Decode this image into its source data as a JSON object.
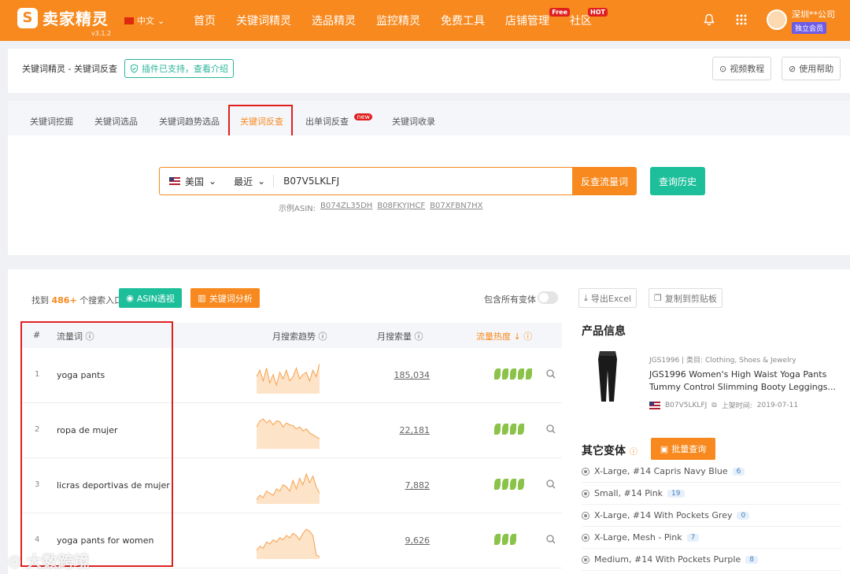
{
  "app": {
    "name": "卖家精灵",
    "version": "v3.1.2",
    "language": "中文"
  },
  "nav": [
    {
      "label": "首页"
    },
    {
      "label": "关键词精灵"
    },
    {
      "label": "选品精灵"
    },
    {
      "label": "监控精灵"
    },
    {
      "label": "免费工具"
    },
    {
      "label": "店铺管理",
      "tag": "Free"
    },
    {
      "label": "社区",
      "tag": "HOT"
    }
  ],
  "user": {
    "company": "深圳**公司",
    "member": "独立会员"
  },
  "header": {
    "breadcrumb": "关键词精灵 - 关键词反查",
    "plugin": "插件已支持，查看介绍",
    "video_btn": "视频教程",
    "help_btn": "使用帮助"
  },
  "tabs": [
    {
      "label": "关键词挖掘"
    },
    {
      "label": "关键词选品"
    },
    {
      "label": "关键词趋势选品"
    },
    {
      "label": "关键词反查"
    },
    {
      "label": "出单词反查",
      "tag": "new"
    },
    {
      "label": "关键词收录"
    }
  ],
  "search": {
    "market": "美国",
    "period": "最近",
    "value": "B07V5LKLFJ",
    "submit": "反查流量词",
    "history": "查询历史",
    "examples_label": "示例ASIN:",
    "examples": [
      "B074ZL35DH",
      "B08FKYJHCF",
      "B07XFBN7HX"
    ]
  },
  "results": {
    "found_prefix": "找到",
    "found_count": "486+",
    "found_suffix": "个搜索入口",
    "asin_btn": "ASIN透视",
    "kw_btn": "关键词分析",
    "variants_label": "包含所有变体",
    "export_btn": "导出Excel",
    "copy_btn": "复制到剪贴板"
  },
  "table": {
    "headers": {
      "num": "#",
      "keyword": "流量词",
      "trend": "月搜索趋势",
      "volume": "月搜索量",
      "heat": "流量热度 ↓"
    },
    "rows": [
      {
        "n": "1",
        "keyword": "yoga pants",
        "volume": "185,034",
        "heat": 5,
        "trend": [
          40,
          55,
          30,
          60,
          25,
          45,
          20,
          50,
          35,
          55,
          30,
          40,
          60,
          35,
          45,
          50,
          30,
          55,
          40,
          70
        ]
      },
      {
        "n": "2",
        "keyword": "ropa de mujer",
        "volume": "22,181",
        "heat": 4,
        "trend": [
          55,
          70,
          75,
          65,
          72,
          60,
          70,
          68,
          55,
          65,
          60,
          58,
          50,
          55,
          45,
          50,
          40,
          35,
          30,
          25
        ]
      },
      {
        "n": "3",
        "keyword": "licras deportivas de mujer",
        "volume": "7,882",
        "heat": 4,
        "trend": [
          10,
          20,
          15,
          30,
          25,
          20,
          35,
          30,
          45,
          40,
          30,
          55,
          35,
          60,
          45,
          70,
          50,
          65,
          40,
          25
        ]
      },
      {
        "n": "4",
        "keyword": "yoga pants for women",
        "volume": "9,626",
        "heat": 3,
        "trend": [
          20,
          30,
          25,
          40,
          35,
          45,
          40,
          50,
          45,
          55,
          50,
          60,
          55,
          45,
          60,
          70,
          65,
          55,
          10,
          5
        ]
      }
    ]
  },
  "product": {
    "section_title": "产品信息",
    "brand": "JGS1996",
    "category_label": "类目:",
    "category": "Clothing, Shoes & Jewelry",
    "title_line1": "JGS1996 Women's High Waist Yoga Pants",
    "title_line2": "Tummy Control Slimming Booty Leggings...",
    "asin": "B07V5LKLFJ",
    "date_label": "上架时间:",
    "date": "2019-07-11"
  },
  "variants": {
    "section_title": "其它变体",
    "batch_btn": "批量查询",
    "items": [
      {
        "label": "X-Large, #14 Capris Navy Blue",
        "count": "6"
      },
      {
        "label": "Small, #14 Pink",
        "count": "19"
      },
      {
        "label": "X-Large, #14 With Pockets Grey",
        "count": "0"
      },
      {
        "label": "X-Large, Mesh - Pink",
        "count": "7"
      },
      {
        "label": "Medium, #14 With Pockets Purple",
        "count": "8"
      }
    ]
  },
  "watermark": "大数跨境",
  "colors": {
    "brand": "#f7891e",
    "teal": "#1dbf9b",
    "red": "#e02020"
  }
}
